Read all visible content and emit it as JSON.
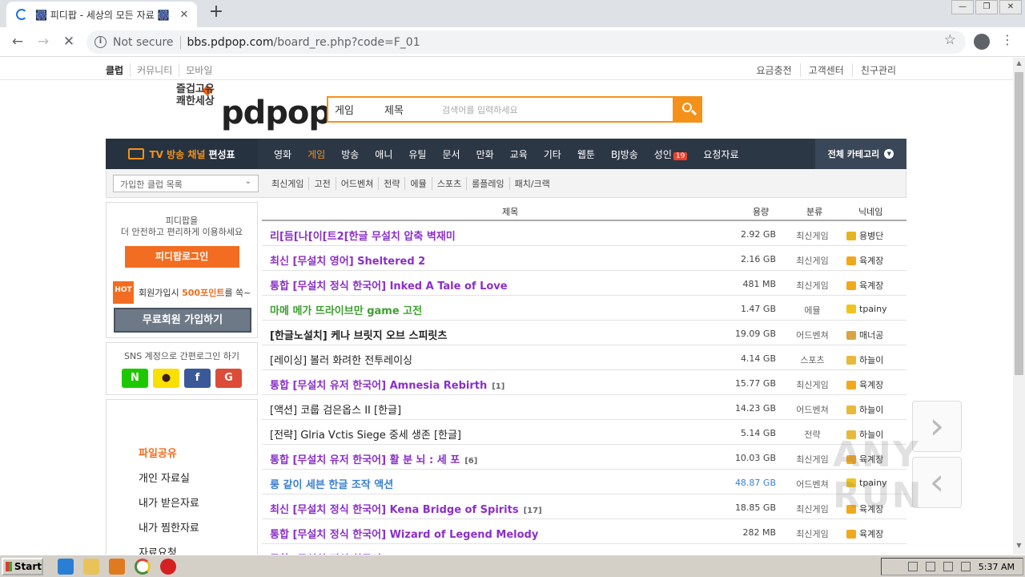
{
  "browser": {
    "tab_title": "🎆 피디팝 - 세상의 모든 자료 🎆",
    "tab_close": "✕",
    "newtab": "+",
    "win_min": "—",
    "win_max": "❐",
    "win_close": "✕",
    "back": "←",
    "forward": "→",
    "stop": "✕",
    "info": "i",
    "not_secure": "Not secure",
    "url_host": "bbs.pdpop.com",
    "url_path": "/board_re.php?code=F_01",
    "star": "☆",
    "menu": "⋮"
  },
  "topbar": {
    "left": [
      "클럽",
      "커뮤니티",
      "모바일"
    ],
    "right": [
      "요금충전",
      "고객센터",
      "친구관리"
    ]
  },
  "logo": {
    "slogan": "즐겁고유쾌한세상",
    "brand": "pdpop"
  },
  "search": {
    "category": "게임",
    "field": "제목",
    "placeholder": "검색어를 입력하세요"
  },
  "gnb": {
    "tv_orange": "TV 방송 채널",
    "tv_white": "편성표",
    "menu": [
      "영화",
      "게임",
      "방송",
      "애니",
      "유틸",
      "문서",
      "만화",
      "교육",
      "기타",
      "웹툰",
      "BJ방송",
      "성인",
      "요청자료"
    ],
    "adult_badge": "19",
    "all_categories": "전체 카테고리",
    "dd": "▼"
  },
  "subbar": {
    "club_select": "가입한 클럽 목록",
    "chevron": "⌄",
    "subcats": [
      "최신게임",
      "고전",
      "어드벤쳐",
      "전략",
      "에뮬",
      "스포츠",
      "롤플레잉",
      "패치/크랙"
    ]
  },
  "login": {
    "desc1": "피디팝을",
    "desc2": "더 안전하고 편리하게 이용하세요",
    "login_btn": "피디팝로그인",
    "hot": "HOT",
    "join_pre": "회원가입시 ",
    "join_pts": "500포인트",
    "join_post": "를 쏙~",
    "join_btn": "무료회원 가입하기"
  },
  "sns": {
    "title": "SNS 계정으로 간편로그인 하기",
    "naver": "N",
    "kakao": "●",
    "facebook": "f",
    "google": "G"
  },
  "sidemenu": [
    "파일공유",
    "개인 자료실",
    "내가 받은자료",
    "내가 찜한자료",
    "자료요청"
  ],
  "board": {
    "headers": {
      "title": "제목",
      "size": "용량",
      "category": "분류",
      "nick": "닉네임"
    },
    "rows": [
      {
        "title": "리[듬[나[이[트2[한글 무설치 압축 벽재미",
        "comments": "",
        "size": "2.92 GB",
        "category": "최신게임",
        "nick": "용병단",
        "style": "c-purple",
        "lvl": "#e6b422"
      },
      {
        "title": "최신 [무설치 영어] Sheltered 2",
        "comments": "",
        "size": "2.16 GB",
        "category": "최신게임",
        "nick": "육계장",
        "style": "c-purple",
        "lvl": "#f2a81d"
      },
      {
        "title": "통합 [무설치 정식 한국어] Inked A Tale of Love",
        "comments": "",
        "size": "481 MB",
        "category": "최신게임",
        "nick": "육계장",
        "style": "c-purple",
        "lvl": "#f2a81d"
      },
      {
        "title": "마메 메가 뜨라이브만 game 고전",
        "comments": "",
        "size": "1.47 GB",
        "category": "에뮬",
        "nick": "tpainy",
        "style": "c-green",
        "lvl": "#f2c21d"
      },
      {
        "title": "[한글노설치] 케나 브릿지 오브 스피릿츠",
        "comments": "",
        "size": "19.09 GB",
        "category": "어드벤쳐",
        "nick": "매너공",
        "style": "c-blackb",
        "lvl": "#d9a441"
      },
      {
        "title": "[레이싱] 볼러 화려한 전투레이싱",
        "comments": "",
        "size": "4.14 GB",
        "category": "스포츠",
        "nick": "하늘이",
        "style": "c-black",
        "lvl": "#e8b93a"
      },
      {
        "title": "통합 [무설치 유저 한국어] Amnesia Rebirth",
        "comments": "[1]",
        "size": "15.77 GB",
        "category": "최신게임",
        "nick": "육계장",
        "style": "c-purple",
        "lvl": "#f2a81d"
      },
      {
        "title": "[액션] 코룹 검은옵스 II [한글]",
        "comments": "",
        "size": "14.23 GB",
        "category": "어드벤쳐",
        "nick": "하늘이",
        "style": "c-black",
        "lvl": "#e8b93a"
      },
      {
        "title": "[전략] Glria Vctis Siege 중세 생존 [한글]",
        "comments": "",
        "size": "5.14 GB",
        "category": "전략",
        "nick": "하늘이",
        "style": "c-black",
        "lvl": "#e8b93a"
      },
      {
        "title": "통합 [무설치 유저 한국어] 활 분 뇌 : 세 포",
        "comments": "[6]",
        "size": "10.03 GB",
        "category": "최신게임",
        "nick": "육계장",
        "style": "c-purple",
        "lvl": "#f2a81d"
      },
      {
        "title": "룽 같이 세븐 한글 조작 액션",
        "comments": "",
        "size": "48.87 GB",
        "category": "어드벤쳐",
        "nick": "tpainy",
        "style": "c-blue",
        "lvl": "#f2c21d"
      },
      {
        "title": "최신 [무설치 정식 한국어] Kena Bridge of Spirits",
        "comments": "[17]",
        "size": "18.85 GB",
        "category": "최신게임",
        "nick": "육계장",
        "style": "c-purple",
        "lvl": "#f2a81d"
      },
      {
        "title": "통합 [무설치 정식 한국어] Wizard of Legend Melody",
        "comments": "",
        "size": "282 MB",
        "category": "최신게임",
        "nick": "육계장",
        "style": "c-purple",
        "lvl": "#f2a81d"
      },
      {
        "title": "통합 [무설치 정식 한국어] ...",
        "comments": "",
        "size": "",
        "category": "",
        "nick": "",
        "style": "c-purple",
        "lvl": "#f2a81d"
      }
    ]
  },
  "arrows": {
    "next": "›",
    "prev": "‹"
  },
  "watermark": "ANY RUN",
  "taskbar": {
    "start": "Start",
    "time": "5:37 AM"
  },
  "colors": {
    "accent": "#f49119",
    "nav": "#2c3746",
    "purple": "#8b2fc9",
    "green": "#3da02e"
  }
}
